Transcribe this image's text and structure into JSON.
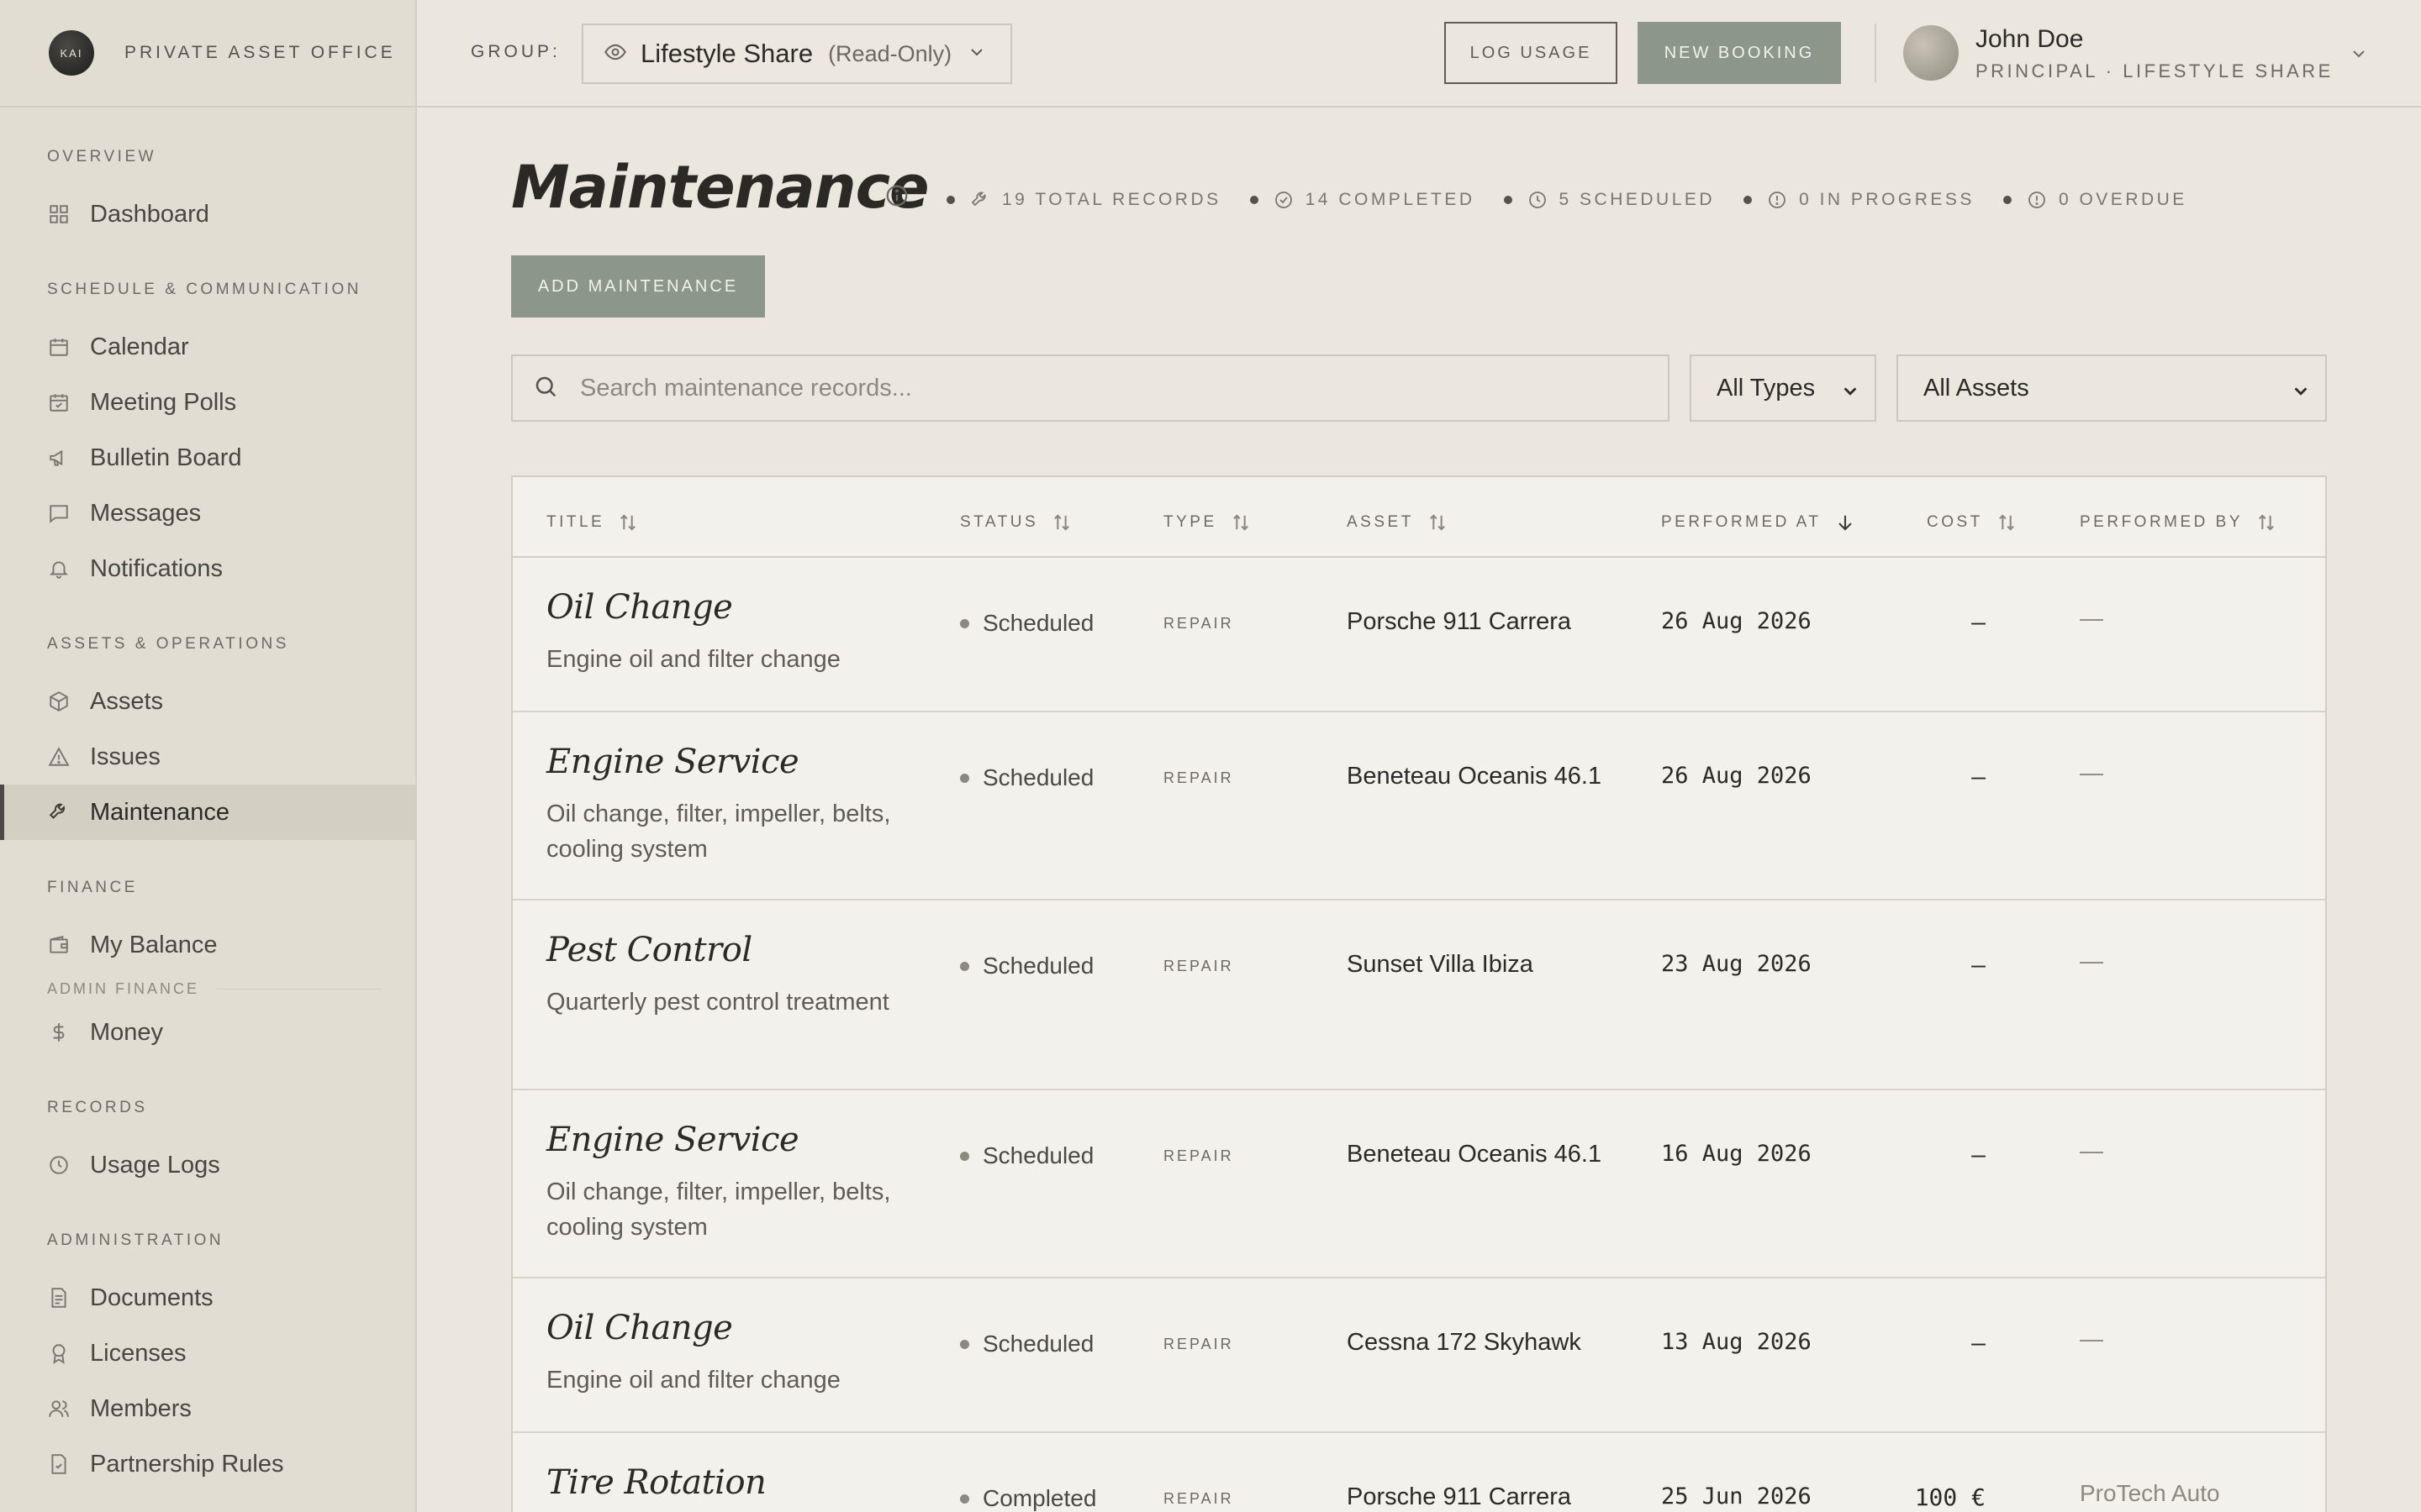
{
  "brand": {
    "logo_text": "KAI",
    "name": "PRIVATE ASSET OFFICE"
  },
  "sidebar": {
    "sections": [
      {
        "title": "OVERVIEW",
        "items": [
          {
            "label": "Dashboard",
            "icon": "grid-icon"
          }
        ]
      },
      {
        "title": "SCHEDULE & COMMUNICATION",
        "items": [
          {
            "label": "Calendar",
            "icon": "calendar-icon"
          },
          {
            "label": "Meeting Polls",
            "icon": "calendar-check-icon"
          },
          {
            "label": "Bulletin Board",
            "icon": "megaphone-icon"
          },
          {
            "label": "Messages",
            "icon": "message-icon"
          },
          {
            "label": "Notifications",
            "icon": "bell-icon"
          }
        ]
      },
      {
        "title": "ASSETS & OPERATIONS",
        "items": [
          {
            "label": "Assets",
            "icon": "box-icon"
          },
          {
            "label": "Issues",
            "icon": "warning-icon"
          },
          {
            "label": "Maintenance",
            "icon": "wrench-icon",
            "active": true
          }
        ]
      },
      {
        "title": "FINANCE",
        "items": [
          {
            "label": "My Balance",
            "icon": "wallet-icon"
          }
        ],
        "subtitle": "ADMIN FINANCE",
        "sub_items": [
          {
            "label": "Money",
            "icon": "dollar-icon"
          }
        ]
      },
      {
        "title": "RECORDS",
        "items": [
          {
            "label": "Usage Logs",
            "icon": "clock-icon"
          }
        ]
      },
      {
        "title": "ADMINISTRATION",
        "items": [
          {
            "label": "Documents",
            "icon": "document-icon"
          },
          {
            "label": "Licenses",
            "icon": "award-icon"
          },
          {
            "label": "Members",
            "icon": "users-icon"
          },
          {
            "label": "Partnership Rules",
            "icon": "file-check-icon"
          }
        ]
      }
    ]
  },
  "topbar": {
    "group_label": "GROUP:",
    "group_name": "Lifestyle Share",
    "group_mode": "(Read-Only)",
    "log_usage": "LOG USAGE",
    "new_booking": "NEW BOOKING",
    "user_name": "John Doe",
    "user_role": "PRINCIPAL · LIFESTYLE SHARE"
  },
  "page": {
    "title": "Maintenance",
    "stats": [
      {
        "label": "19 TOTAL RECORDS",
        "icon": "wrench-icon"
      },
      {
        "label": "14 COMPLETED",
        "icon": "check-circle-icon"
      },
      {
        "label": "5 SCHEDULED",
        "icon": "clock-icon"
      },
      {
        "label": "0 IN PROGRESS",
        "icon": "alert-circle-icon"
      },
      {
        "label": "0 OVERDUE",
        "icon": "alert-circle-icon"
      }
    ],
    "add_button": "ADD MAINTENANCE",
    "search_placeholder": "Search maintenance records...",
    "type_filter": "All Types",
    "asset_filter": "All Assets"
  },
  "table": {
    "columns": [
      "TITLE",
      "STATUS",
      "TYPE",
      "ASSET",
      "PERFORMED AT",
      "COST",
      "PERFORMED BY"
    ],
    "rows": [
      {
        "title": "Oil Change",
        "desc": "Engine oil and filter change",
        "status": "Scheduled",
        "type": "REPAIR",
        "asset": "Porsche 911 Carrera",
        "date": "26 Aug 2026",
        "cost": "—",
        "by": "—"
      },
      {
        "title": "Engine Service",
        "desc": "Oil change, filter, impeller, belts, cooling system",
        "status": "Scheduled",
        "type": "REPAIR",
        "asset": "Beneteau Oceanis 46.1",
        "date": "26 Aug 2026",
        "cost": "—",
        "by": "—"
      },
      {
        "title": "Pest Control",
        "desc": "Quarterly pest control treatment",
        "status": "Scheduled",
        "type": "REPAIR",
        "asset": "Sunset Villa Ibiza",
        "date": "23 Aug 2026",
        "cost": "—",
        "by": "—"
      },
      {
        "title": "Engine Service",
        "desc": "Oil change, filter, impeller, belts, cooling system",
        "status": "Scheduled",
        "type": "REPAIR",
        "asset": "Beneteau Oceanis 46.1",
        "date": "16 Aug 2026",
        "cost": "—",
        "by": "—"
      },
      {
        "title": "Oil Change",
        "desc": "Engine oil and filter change",
        "status": "Scheduled",
        "type": "REPAIR",
        "asset": "Cessna 172 Skyhawk",
        "date": "13 Aug 2026",
        "cost": "—",
        "by": "—"
      },
      {
        "title": "Tire Rotation",
        "desc": "",
        "status": "Completed",
        "type": "REPAIR",
        "asset": "Porsche 911 Carrera",
        "date": "25 Jun 2026",
        "cost": "100 €",
        "by": "ProTech Auto"
      }
    ]
  }
}
